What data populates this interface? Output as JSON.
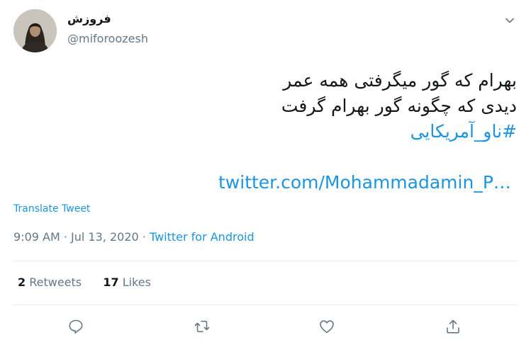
{
  "user": {
    "display_name": "فروزش",
    "handle": "@miforoozesh"
  },
  "tweet": {
    "lines": [
      "بهرام که گور میگرفتی همه عمر",
      "دیدی که چگونه گور بهرام گرفت"
    ],
    "hashtag": "#ناو_آمریکایی",
    "link": "twitter.com/Mohammadamin_P…",
    "translate_label": "Translate Tweet"
  },
  "meta": {
    "time": "9:09 AM",
    "separator1": " · ",
    "date": "Jul 13, 2020",
    "separator2": " · ",
    "source": "Twitter for Android"
  },
  "stats": {
    "retweets_count": "2",
    "retweets_label": "Retweets",
    "likes_count": "17",
    "likes_label": "Likes"
  },
  "icons": {
    "caret": "chevron-down-icon",
    "reply": "reply-icon",
    "retweet": "retweet-icon",
    "like": "heart-icon",
    "share": "share-icon"
  },
  "colors": {
    "link": "#1b95e0",
    "muted": "#657786",
    "text": "#14171a",
    "divider": "#e6ecf0"
  }
}
